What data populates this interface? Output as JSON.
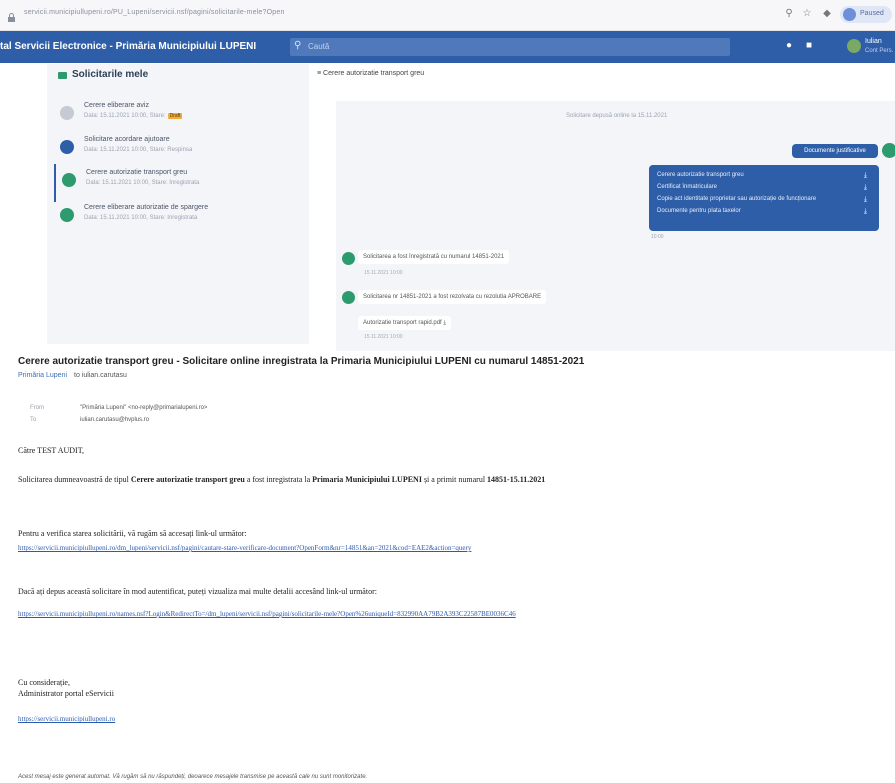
{
  "browser": {
    "url": "servicii.municipiullupeni.ro/PU_Lupeni/servicii.nsf/pagini/solicitarile-mele?Open",
    "profile_label": "Paused"
  },
  "header": {
    "title": "tal Servicii Electronice - Primăria Municipiului LUPENI",
    "search_placeholder": "Caută",
    "user_name": "Iulian",
    "user_sub": "Cont Pers."
  },
  "left": {
    "title": "Solicitarile mele",
    "items": [
      {
        "title": "Cerere eliberare aviz",
        "meta": "Data: 15.11.2021 10:00, Stare:",
        "badge": "Draft",
        "color": "#c5cad3"
      },
      {
        "title": "Solicitare acordare ajutoare",
        "meta": "Data: 15.11.2021 10:00, Stare: Respinsa",
        "badge": "",
        "color": "#2e5ea8"
      },
      {
        "title": "Cerere autorizatie transport greu",
        "meta": "Data: 15.11.2021 10:00, Stare: Inregistrata",
        "badge": "",
        "color": "#2d9b6e"
      },
      {
        "title": "Cerere eliberare autorizatie de spargere",
        "meta": "Data: 15.11.2021 10:00, Stare: Inregistrata",
        "badge": "",
        "color": "#2d9b6e"
      }
    ]
  },
  "right": {
    "title": "Cerere autorizatie transport greu",
    "conversation_date": "Solicitare depusă online la 15.11.2021",
    "docs_pill": "Documente justificative",
    "docs": [
      "Cerere autorizatie transport greu",
      "Certificat înmatriculare",
      "Copie act identitate proprietar sau autorizație de funcționare",
      "Documente pentru plata taxelor"
    ],
    "docs_time": "10:00",
    "msg1": "Solicitarea a fost înregistrată cu numarul 14851-2021",
    "msg1_time": "15.11.2021 10:00",
    "msg2": "Solicitarea nr 14851-2021 a fost rezolvata cu rezolutia APROBARE",
    "msg3_file": "Autorizatie transport rapid.pdf",
    "msg3_time": "15.11.2021 10:00"
  },
  "email": {
    "subject": "Cerere autorizatie transport greu - Solicitare online inregistrata la Primaria Municipiului LUPENI cu numarul 14851-2021",
    "sender": "Primăria Lupeni",
    "to_short": "to iulian.carutasu",
    "from_label": "From",
    "from_value": "\"Primăria Lupeni\" <no-reply@primarialupeni.ro>",
    "to_label": "To",
    "to_value": "iulian.carutasu@hvplus.ro",
    "greeting": "Către TEST AUDIT,",
    "p1_a": "Solicitarea dumneavoastră de tipul ",
    "p1_b": "Cerere autorizatie transport greu",
    "p1_c": " a fost inregistrata la ",
    "p1_d": "Primaria Municipiului LUPENI",
    "p1_e": " și a primit numarul ",
    "p1_f": "14851-15.11.2021",
    "p2": "Pentru a verifica starea solicitării, vă rugăm să accesați link-ul următor:",
    "link1": "https://servicii.municipiullupeni.ro/dm_lupeni/servicii.nsf/pagini/cautare-stare-verificare-document?OpenForm&nr=14851&an=2021&cod=EAE2&action=query",
    "p3": "Dacă ați depus această solicitare în mod autentificat, puteți vizualiza mai multe detalii accesând link-ul următor:",
    "link2": "https://servicii.municipiullupeni.ro/names.nsf?Login&RedirectTo=/dm_lupeni/servicii.nsf/pagini/solicitarile-mele?Open%26uniqueId=832990AA79B2A393C22587BE0036C46",
    "closing1": "Cu considerație,",
    "closing2": "Administrator portal eServicii",
    "link3": "https://servicii.municipiullupeni.ro",
    "footer": "Acest mesaj este generat automat. Vă rugăm să nu răspundeți, deoarece mesajele transmise pe această cale nu sunt monitorizate."
  }
}
